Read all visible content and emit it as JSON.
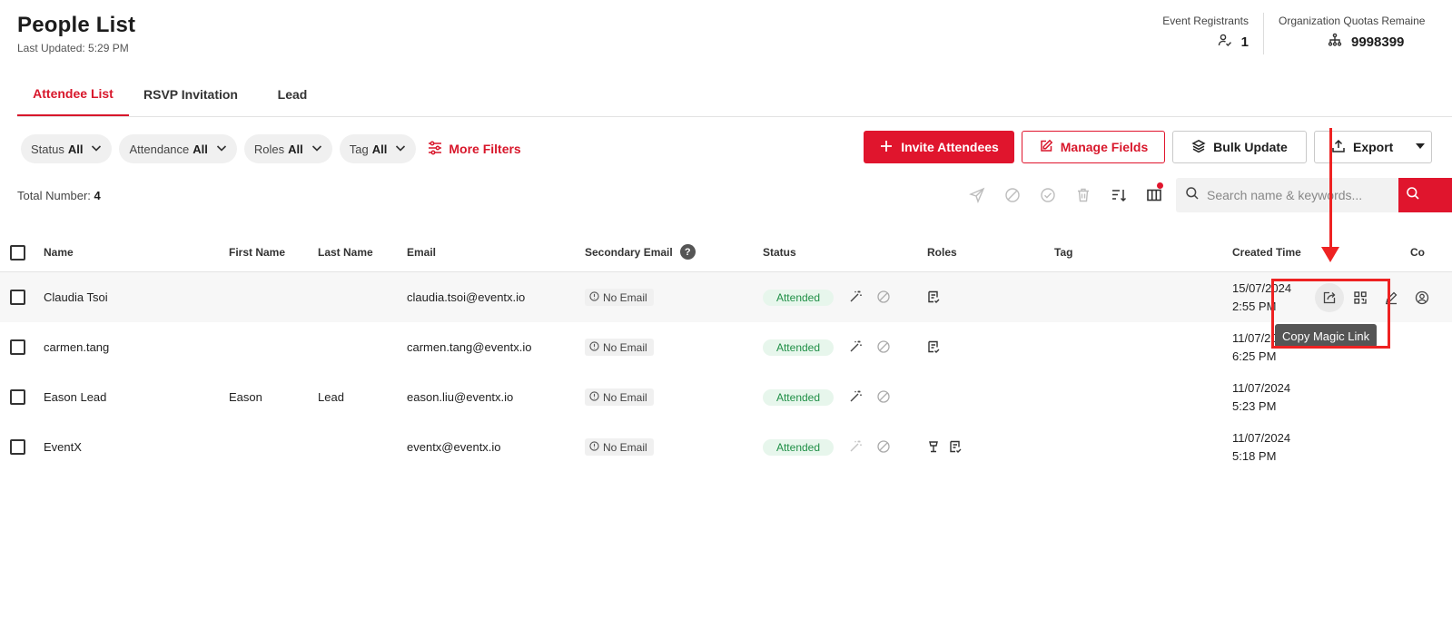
{
  "header": {
    "title": "People List",
    "last_updated": "Last Updated: 5:29 PM",
    "stats": {
      "registrants_label": "Event Registrants",
      "registrants_value": "1",
      "quotas_label": "Organization Quotas Remaine",
      "quotas_value": "9998399"
    }
  },
  "tabs": [
    "Attendee List",
    "RSVP Invitation",
    "Lead"
  ],
  "filters": [
    {
      "label": "Status",
      "value": "All"
    },
    {
      "label": "Attendance",
      "value": "All"
    },
    {
      "label": "Roles",
      "value": "All"
    },
    {
      "label": "Tag",
      "value": "All"
    }
  ],
  "more_filters": "More Filters",
  "actions": {
    "invite": "Invite Attendees",
    "manage": "Manage Fields",
    "bulk": "Bulk Update",
    "export": "Export"
  },
  "total": {
    "label": "Total Number:",
    "value": "4"
  },
  "search": {
    "placeholder": "Search name & keywords..."
  },
  "columns": {
    "name": "Name",
    "first_name": "First Name",
    "last_name": "Last Name",
    "email": "Email",
    "secondary_email": "Secondary Email",
    "status": "Status",
    "roles": "Roles",
    "tag": "Tag",
    "created_time": "Created Time",
    "extra": "Co"
  },
  "rows": [
    {
      "name": "Claudia Tsoi",
      "first_name": "",
      "last_name": "",
      "email": "claudia.tsoi@eventx.io",
      "secondary_email": "No Email",
      "status": "Attended",
      "created_date": "15/07/2024",
      "created_time": "2:55 PM"
    },
    {
      "name": "carmen.tang",
      "first_name": "",
      "last_name": "",
      "email": "carmen.tang@eventx.io",
      "secondary_email": "No Email",
      "status": "Attended",
      "created_date": "11/07/2024",
      "created_time": "6:25 PM"
    },
    {
      "name": "Eason Lead",
      "first_name": "Eason",
      "last_name": "Lead",
      "email": "eason.liu@eventx.io",
      "secondary_email": "No Email",
      "status": "Attended",
      "created_date": "11/07/2024",
      "created_time": "5:23 PM"
    },
    {
      "name": "EventX",
      "first_name": "",
      "last_name": "",
      "email": "eventx@eventx.io",
      "secondary_email": "No Email",
      "status": "Attended",
      "created_date": "11/07/2024",
      "created_time": "5:18 PM"
    }
  ],
  "tooltip": "Copy Magic Link",
  "colors": {
    "accent": "#e0152d",
    "annotation": "#ee2222",
    "attended_bg": "#e7f6ec",
    "attended_text": "#1f8f46"
  }
}
